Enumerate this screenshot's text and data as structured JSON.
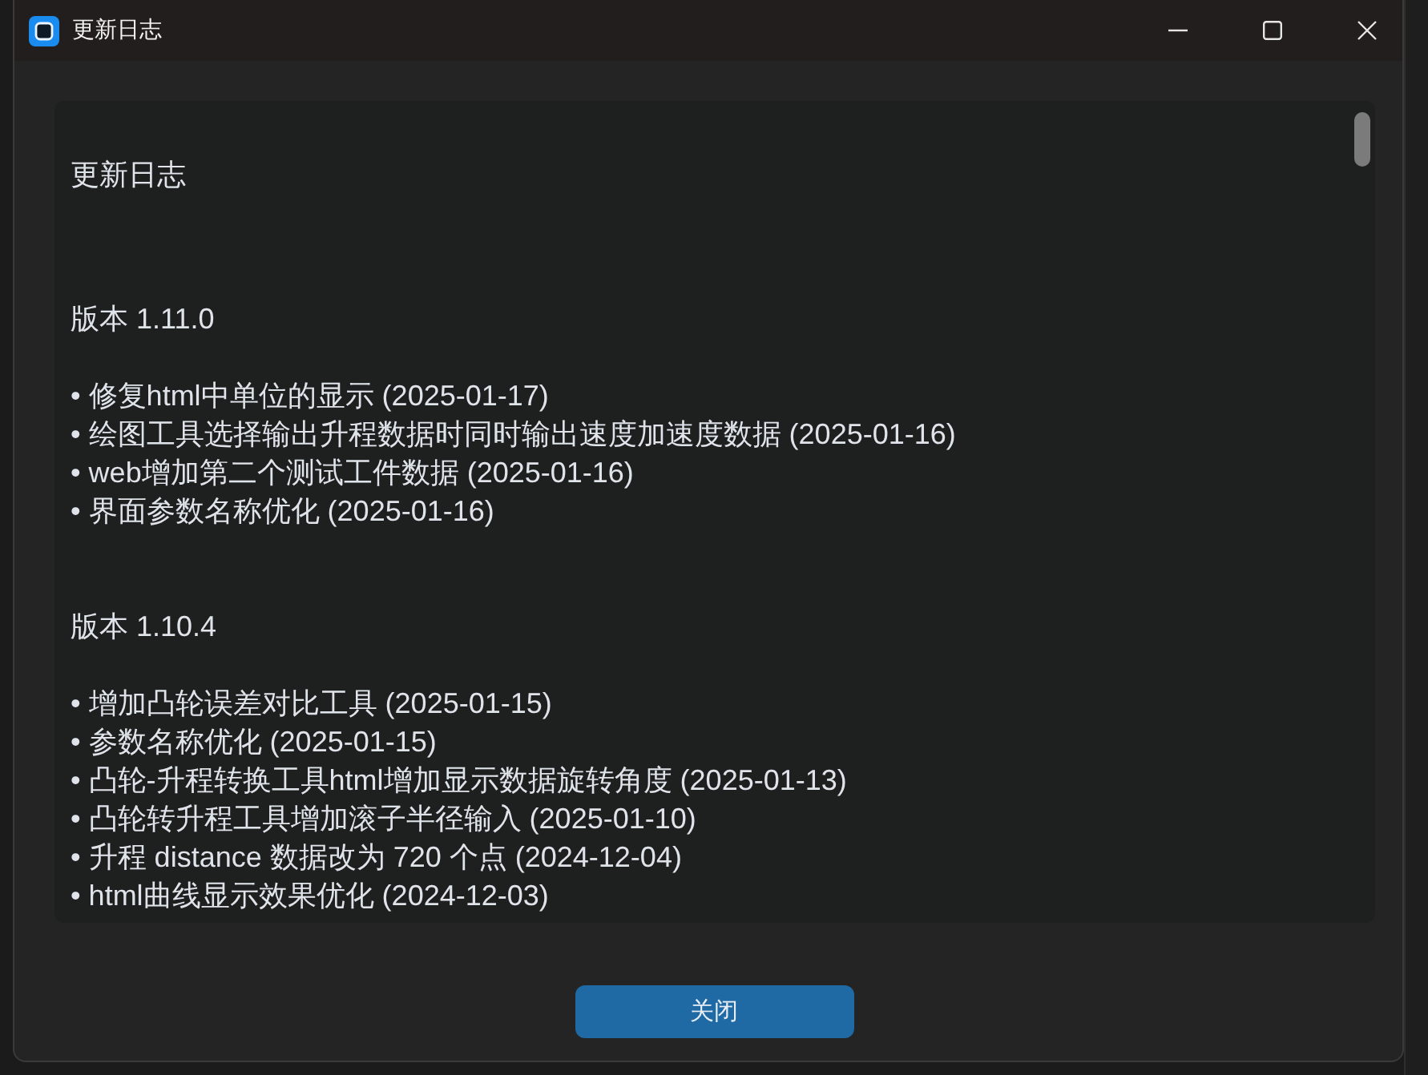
{
  "window": {
    "title": "更新日志"
  },
  "changelog": {
    "heading": "更新日志",
    "versions": [
      {
        "title": "版本 1.11.0",
        "items": [
          "• 修复html中单位的显示 (2025-01-17)",
          "• 绘图工具选择输出升程数据时同时输出速度加速度数据 (2025-01-16)",
          "• web增加第二个测试工件数据 (2025-01-16)",
          "• 界面参数名称优化 (2025-01-16)"
        ]
      },
      {
        "title": "版本 1.10.4",
        "items": [
          "• 增加凸轮误差对比工具 (2025-01-15)",
          "• 参数名称优化 (2025-01-15)",
          "• 凸轮-升程转换工具html增加显示数据旋转角度 (2025-01-13)",
          "• 凸轮转升程工具增加滚子半径输入 (2025-01-10)",
          "• 升程 distance 数据改为 720 个点 (2024-12-04)",
          "• html曲线显示效果优化 (2024-12-03)"
        ]
      }
    ]
  },
  "buttons": [
    {
      "label": "关闭"
    }
  ]
}
